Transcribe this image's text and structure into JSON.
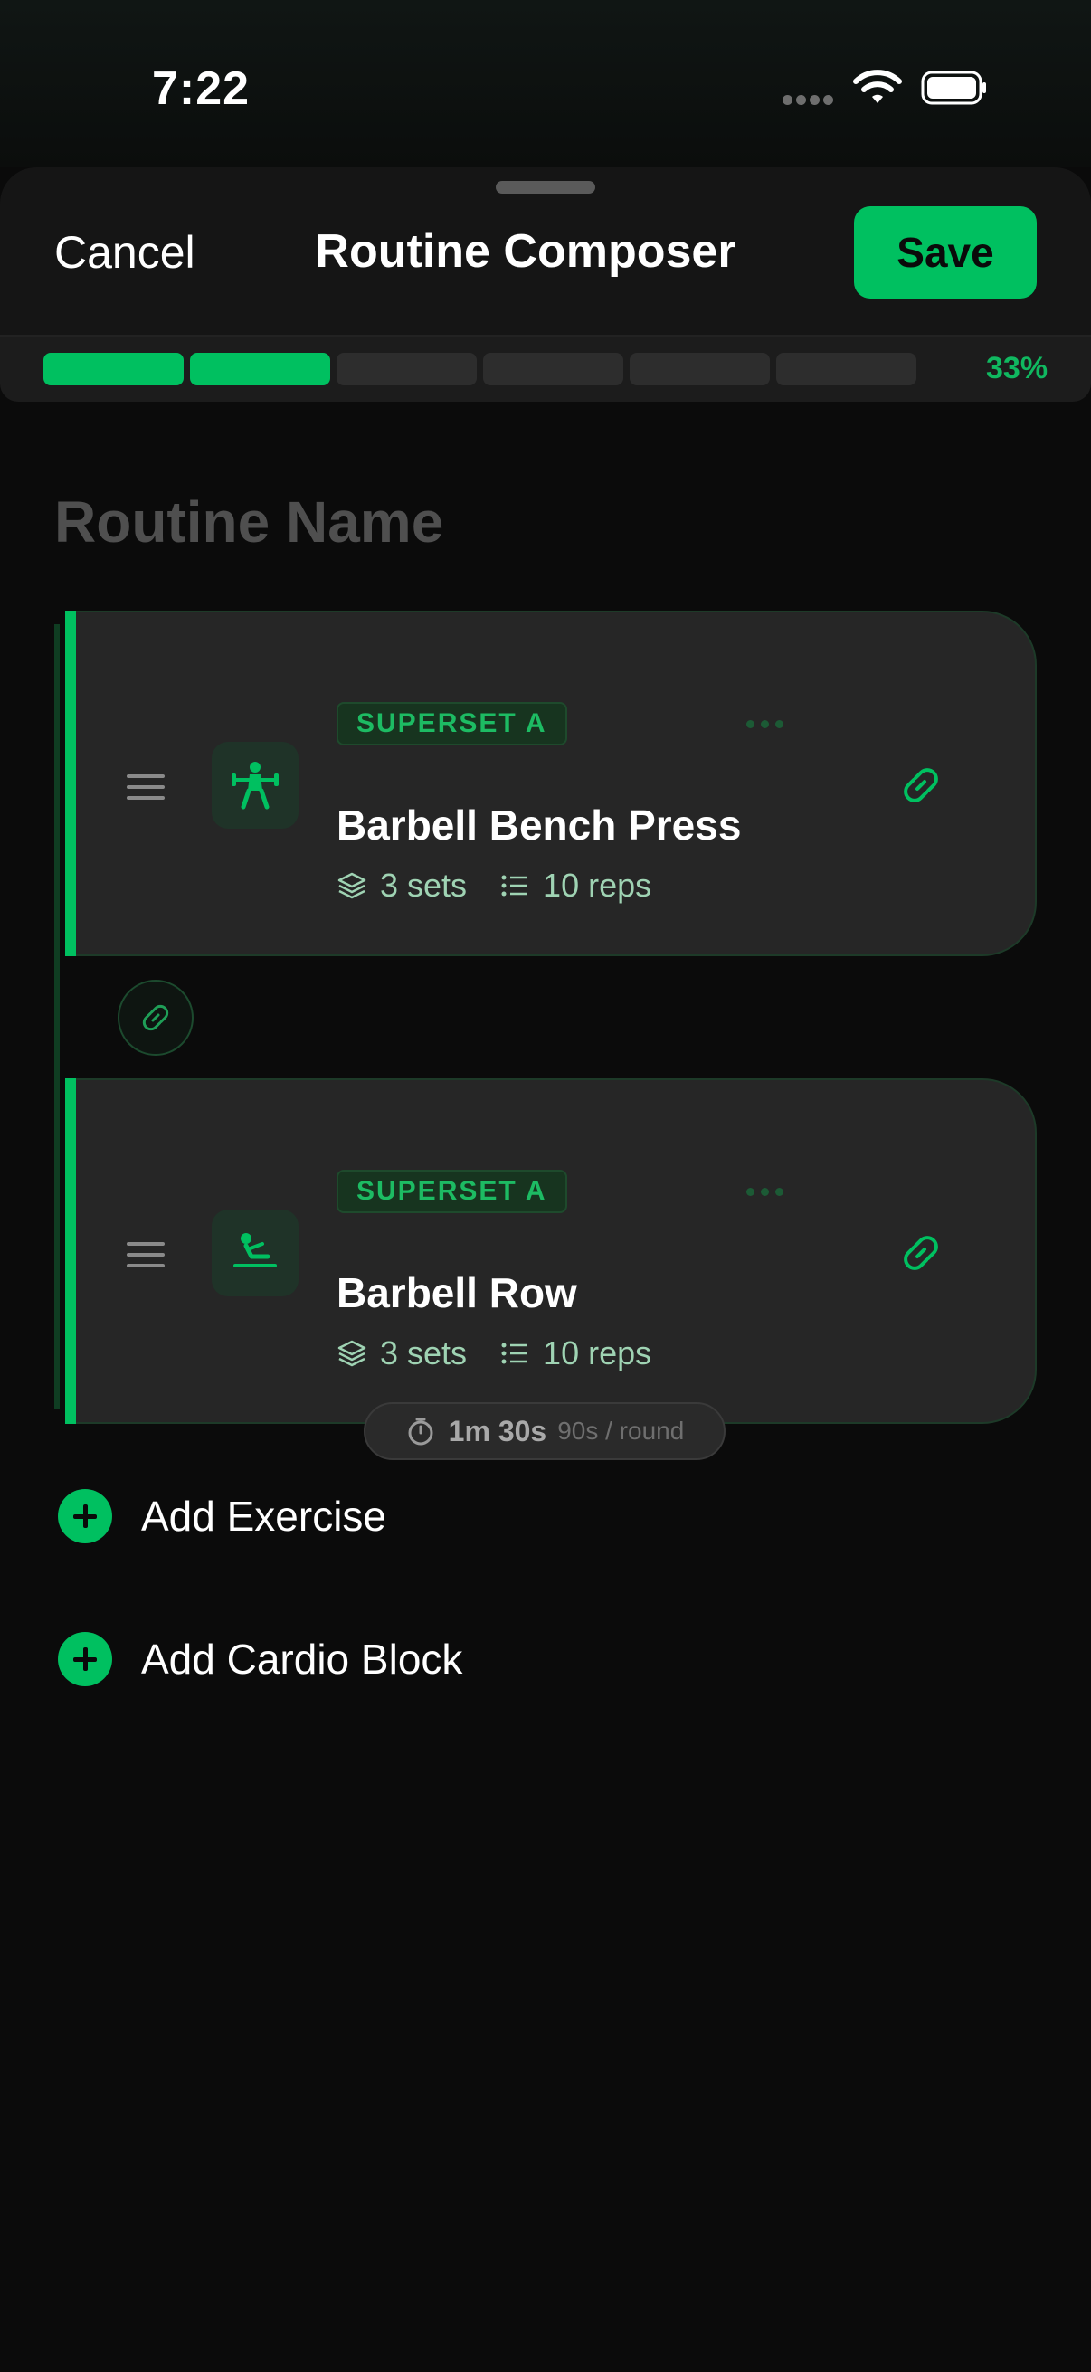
{
  "status_bar": {
    "time": "7:22"
  },
  "header": {
    "cancel_label": "Cancel",
    "title": "Routine Composer",
    "save_label": "Save"
  },
  "progress": {
    "segments_total": 6,
    "segments_done": 2,
    "percent_label": "33%"
  },
  "routine": {
    "name_placeholder": "Routine Name"
  },
  "exercises": [
    {
      "badge": "SUPERSET A",
      "name": "Barbell Bench Press",
      "sets": "3 sets",
      "reps": "10 reps",
      "icon": "weightlifter-icon"
    },
    {
      "badge": "SUPERSET A",
      "name": "Barbell Row",
      "sets": "3 sets",
      "reps": "10 reps",
      "icon": "rowing-icon"
    }
  ],
  "rest": {
    "time": "1m 30s",
    "sub": "90s / round"
  },
  "actions": {
    "add_exercise": "Add Exercise",
    "add_cardio": "Add Cardio Block"
  },
  "colors": {
    "accent": "#00c060",
    "background": "#0a0a0a",
    "card": "#262626"
  }
}
